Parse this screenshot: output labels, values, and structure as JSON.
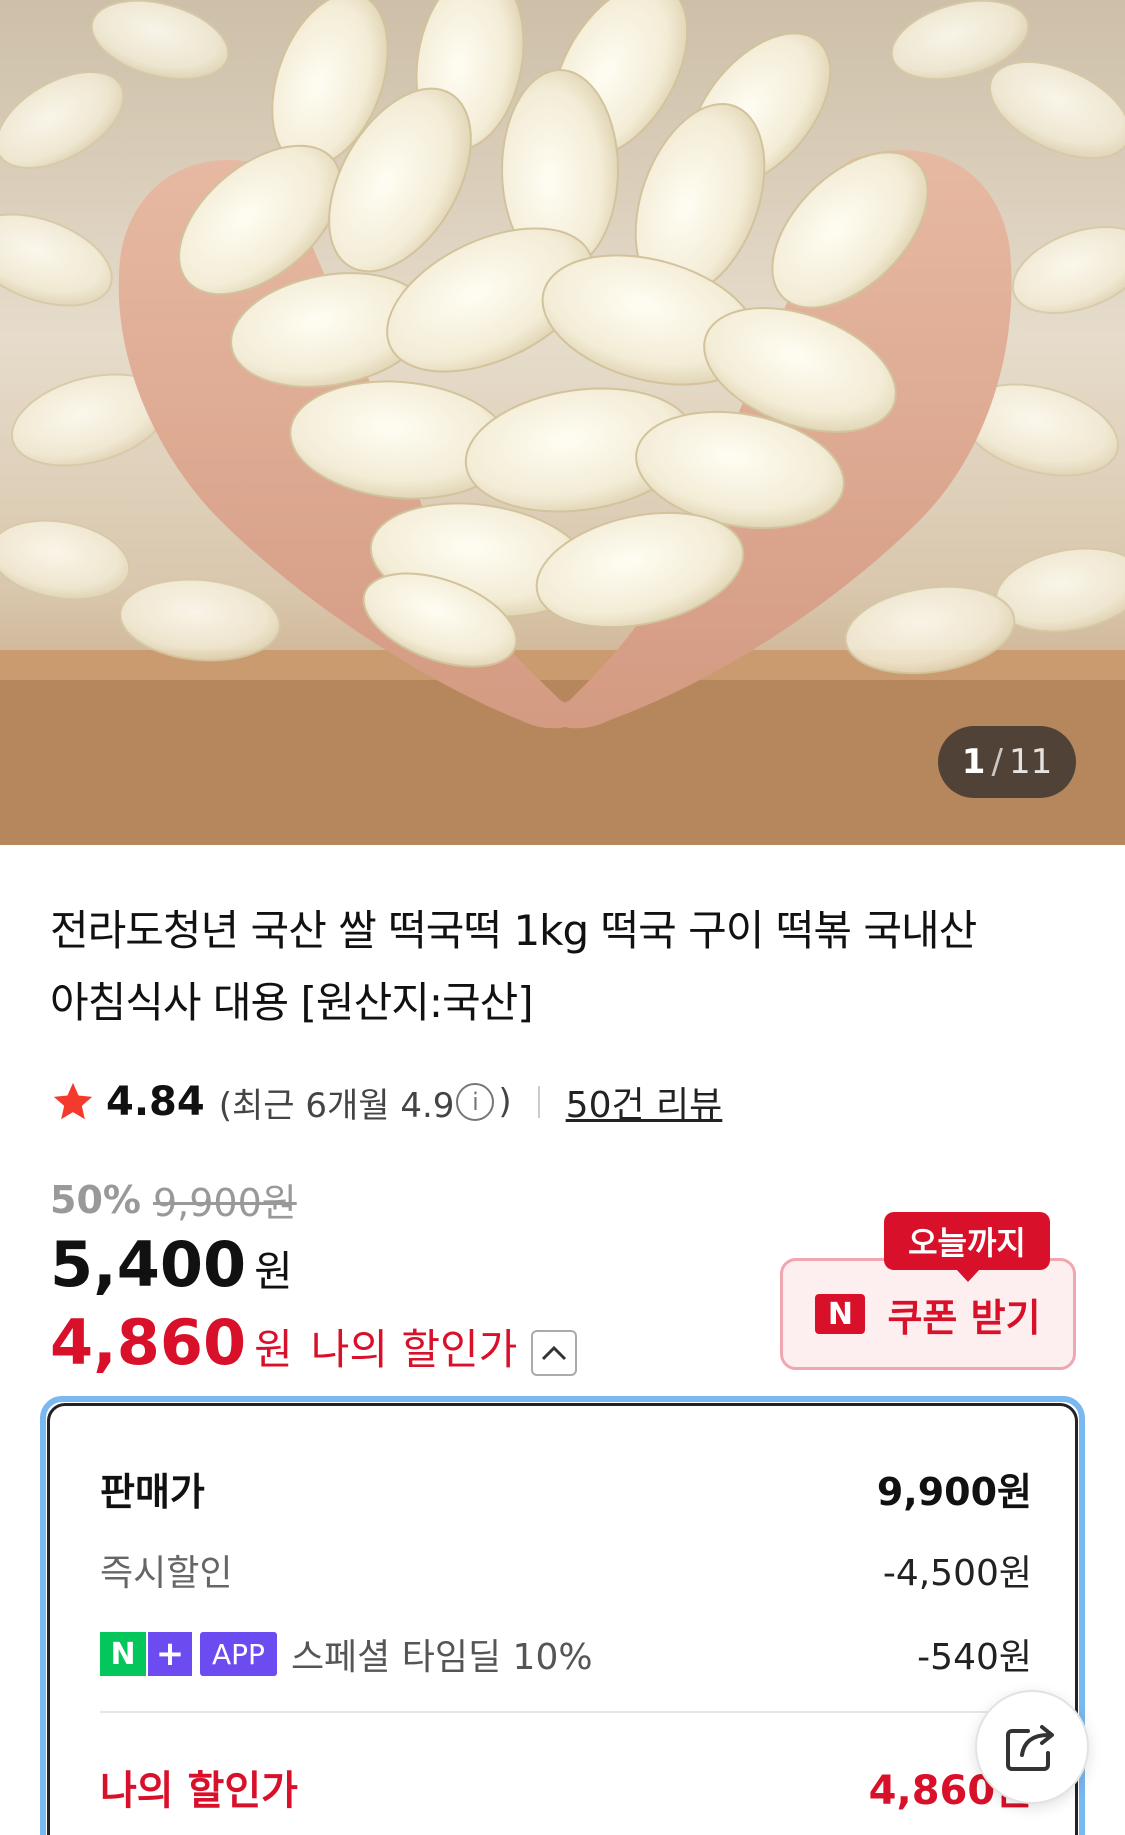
{
  "gallery": {
    "current": "1",
    "separator": "/",
    "total": "11",
    "image_icon": "product-photo-rice-cake-slices"
  },
  "product": {
    "title_line1": "전라도청년 국산 쌀 떡국떡 1kg 떡국 구이 떡볶 국내산",
    "title_line2": "아침식사 대용 [원산지:국산]"
  },
  "rating": {
    "star_icon": "star-icon",
    "score": "4.84",
    "recent_open": "(최근 6개월 4.9",
    "recent_close": ")",
    "info_glyph": "i",
    "reviews": "50건 리뷰"
  },
  "price": {
    "discount_pct": "50%",
    "original": "9,900원",
    "sale_num": "5,400",
    "sale_unit": "원",
    "my_num": "4,860",
    "my_unit": "원",
    "my_label": "나의 할인가"
  },
  "coupon": {
    "tag": "오늘까지",
    "logo": "N",
    "button": "쿠폰 받기"
  },
  "breakdown": {
    "sale_label": "판매가",
    "sale_value": "9,900원",
    "instant_label": "즉시할인",
    "instant_value": "-4,500원",
    "nplus_badge_n": "N",
    "nplus_badge_plus": "+",
    "nplus_badge_app": "APP",
    "nplus_label": "스페셜 타임딜 10%",
    "nplus_value": "-540원",
    "mine_label": "나의 할인가",
    "mine_value": "4,860원"
  },
  "colors": {
    "accent_red": "#d8102a",
    "naver_green": "#03c75a",
    "nplus_purple": "#6c4cf0",
    "focus_blue": "#7ab8f0"
  }
}
